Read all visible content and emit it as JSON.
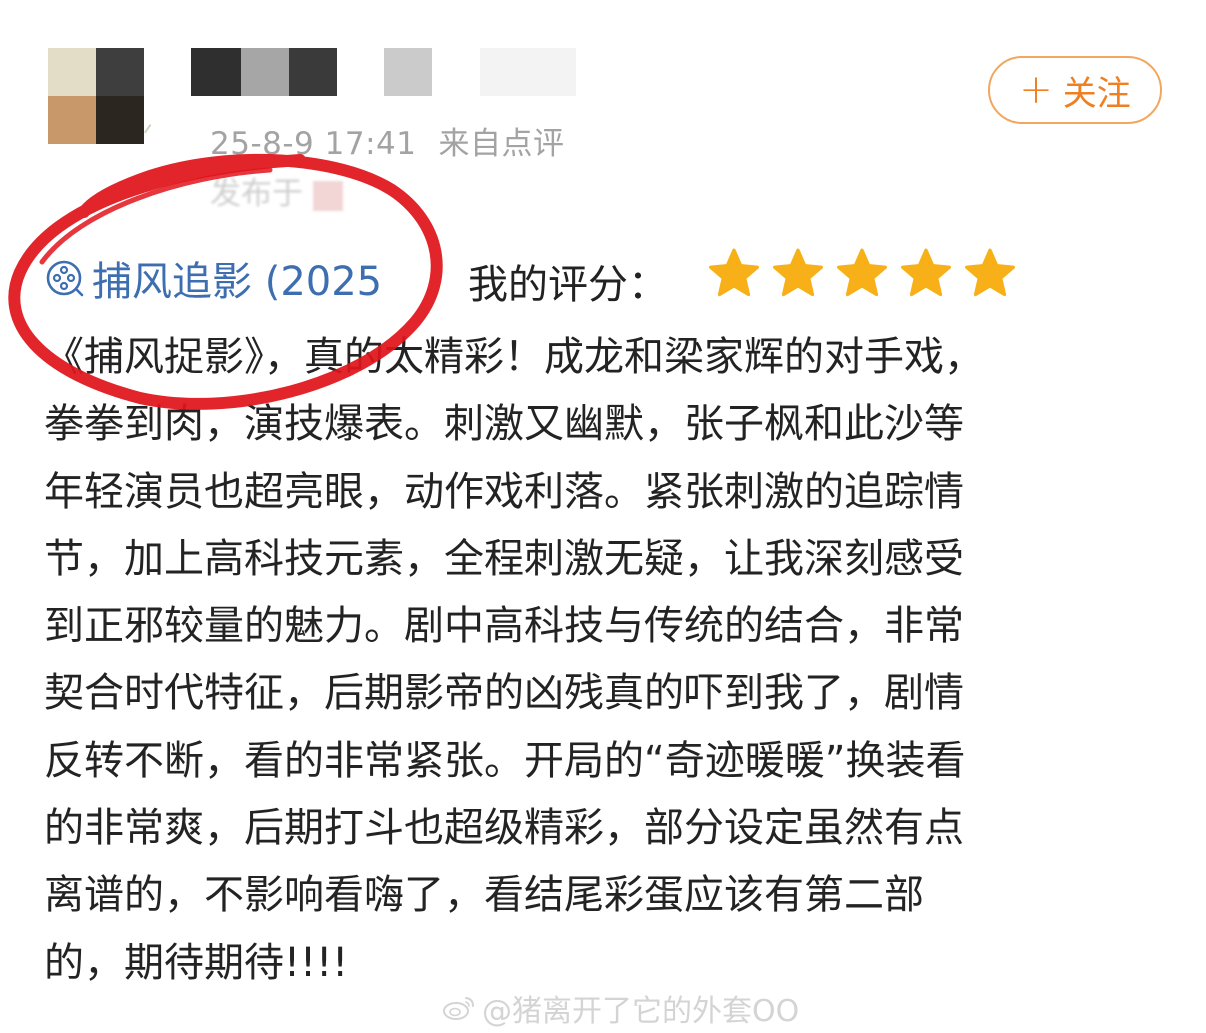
{
  "post": {
    "timestamp": "25-8-9 17:41",
    "source": "来自点评",
    "published_from": "发布于"
  },
  "follow_button": {
    "label": "关注"
  },
  "review": {
    "movie_title": "捕风追影 (2025",
    "rating_label": "我的评分：",
    "rating_stars": 5,
    "lines": [
      "《捕风捉影》，真的太精彩！成龙和梁家辉的对手戏，",
      "拳拳到肉，演技爆表。刺激又幽默，张子枫和此沙等",
      "年轻演员也超亮眼，动作戏利落。紧张刺激的追踪情",
      "节，加上高科技元素，全程刺激无疑，让我深刻感受",
      "到正邪较量的魅力。剧中高科技与传统的结合，非常",
      "契合时代特征，后期影帝的凶残真的吓到我了，剧情",
      "反转不断，看的非常紧张。开局的“奇迹暖暖”换装看",
      "的非常爽，后期打斗也超级精彩，部分设定虽然有点",
      "离谱的，不影响看嗨了，看结尾彩蛋应该有第二部",
      "的，期待期待!!!!"
    ]
  },
  "watermark": {
    "text": "@猪离开了它的外套OO"
  },
  "colors": {
    "accent_orange": "#f07f22",
    "star_yellow": "#f7b018",
    "link_blue": "#3d6fb0",
    "annotation_red": "#e0141b"
  },
  "icons": {
    "movie": "film-reel-icon",
    "star": "star-icon",
    "plus": "plus-icon",
    "weibo": "weibo-logo-icon"
  }
}
